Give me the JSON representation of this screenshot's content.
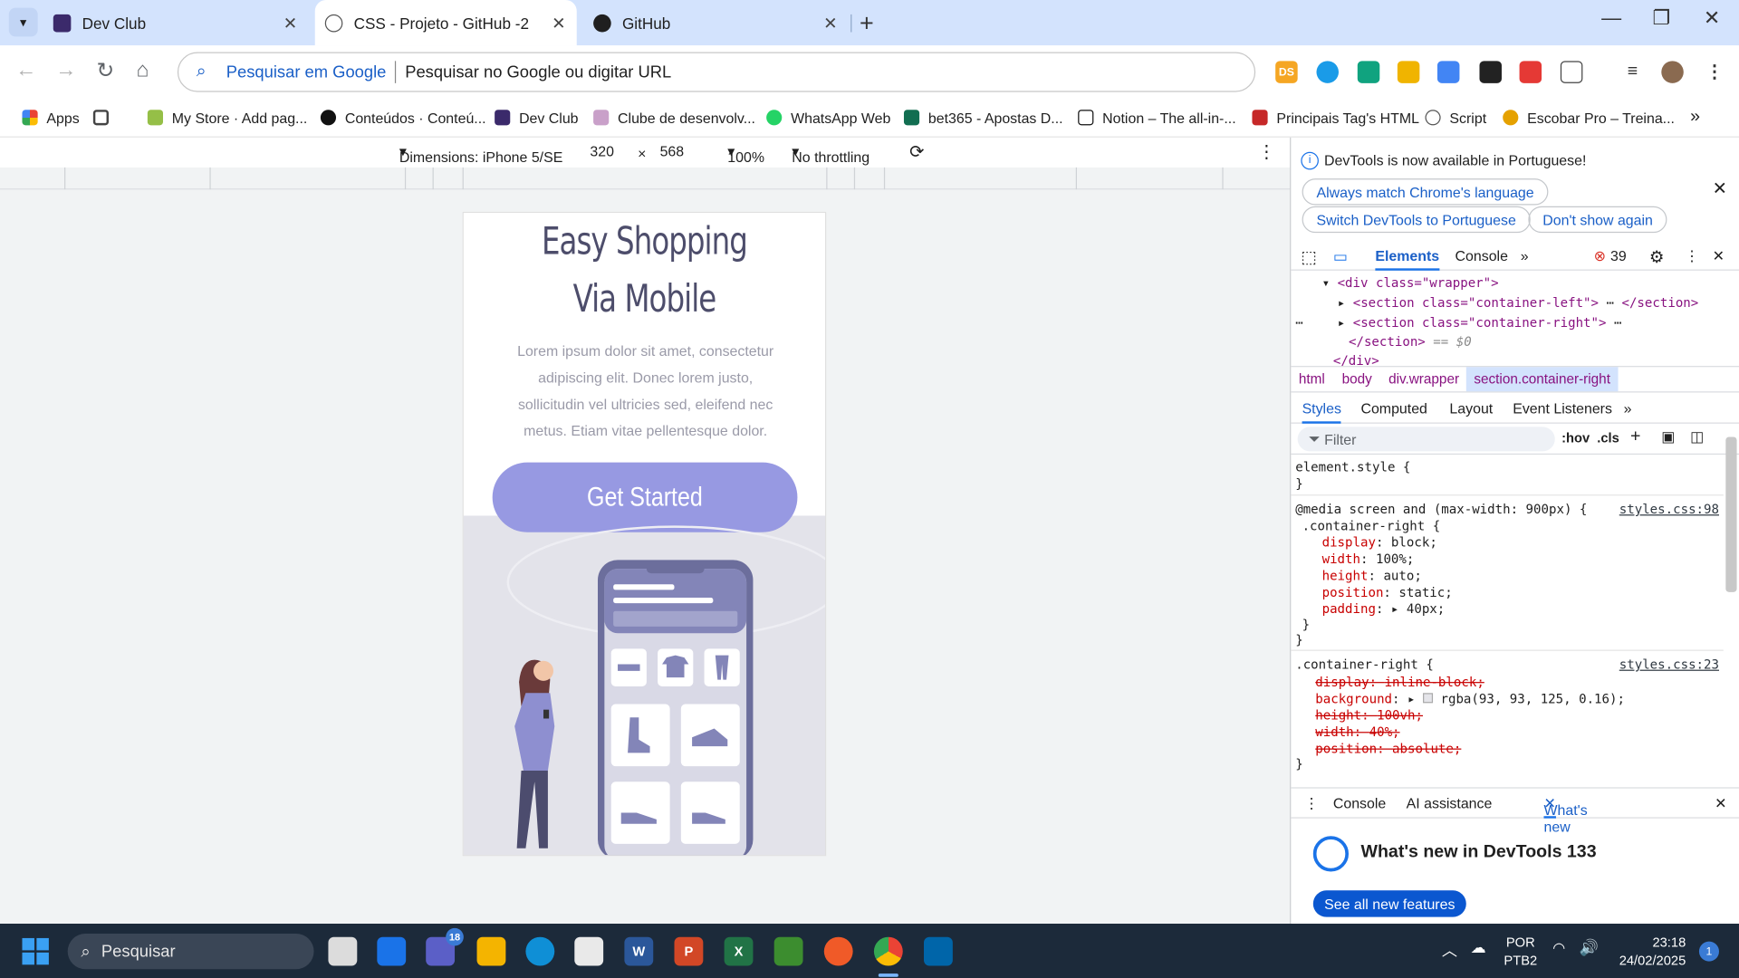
{
  "browser": {
    "tabs": [
      {
        "title": "Dev Club",
        "active": false
      },
      {
        "title": "CSS - Projeto - GitHub -2",
        "active": true
      },
      {
        "title": "GitHub",
        "active": false
      }
    ],
    "new_tab": "+",
    "omnibox": {
      "hint": "Pesquisar em Google",
      "placeholder": "Pesquisar no Google ou digitar URL"
    },
    "bookmarks": [
      "Apps",
      "My Store · Add pag...",
      "Conteúdos · Conteú...",
      "Dev Club",
      "Clube de desenvolv...",
      "WhatsApp Web",
      "bet365 - Apostas D...",
      "Notion – The all-in-...",
      "Principais Tag's HTML",
      "Script",
      "Escobar Pro – Treina..."
    ]
  },
  "device_toolbar": {
    "dimensions": "Dimensions: iPhone 5/SE",
    "width": "320",
    "times": "×",
    "height": "568",
    "zoom": "100%",
    "throttling": "No throttling"
  },
  "page": {
    "title_line1": "Easy Shopping",
    "title_line2": "Via Mobile",
    "text": "Lorem ipsum dolor sit amet, consectetur adipiscing elit. Donec lorem justo, sollicitudin vel ultricies sed, eleifend nec metus. Etiam vitae pellentesque dolor.",
    "cta": "Get Started"
  },
  "devtools": {
    "info": "DevTools is now available in Portuguese!",
    "pills": [
      "Always match Chrome's language",
      "Switch DevTools to Portuguese",
      "Don't show again"
    ],
    "tabs": [
      "Elements",
      "Console"
    ],
    "error_count": "39",
    "dom": {
      "wrapper_open": "<div class=\"wrapper\">",
      "left": "<section class=\"container-left\">",
      "left_close": "</section>",
      "right": "<section class=\"container-right\">",
      "right_close": "</section>",
      "eq": "== $0",
      "div_close": "</div>"
    },
    "crumbs": [
      "html",
      "body",
      "div.wrapper",
      "section.container-right"
    ],
    "style_tabs": [
      "Styles",
      "Computed",
      "Layout",
      "Event Listeners"
    ],
    "filter": "Filter",
    "hov": ":hov",
    "cls": ".cls",
    "rules": {
      "element_style": "element.style {",
      "close": "}",
      "media": "@media screen and (max-width: 900px) {",
      "media_selector": ".container-right {",
      "media_src": "styles.css:98",
      "media_props": [
        {
          "name": "display",
          "value": "block;"
        },
        {
          "name": "width",
          "value": "100%;"
        },
        {
          "name": "height",
          "value": "auto;"
        },
        {
          "name": "position",
          "value": "static;"
        },
        {
          "name": "padding",
          "value": "40px;"
        }
      ],
      "base_selector": ".container-right {",
      "base_src": "styles.css:23",
      "base_props": [
        {
          "name": "display",
          "value": "inline-block;",
          "struck": true
        },
        {
          "name": "background",
          "value": "rgba(93, 93, 125, 0.16);",
          "struck": false
        },
        {
          "name": "height",
          "value": "100vh;",
          "struck": true
        },
        {
          "name": "width",
          "value": "40%;",
          "struck": true
        },
        {
          "name": "position",
          "value": "absolute;",
          "struck": true
        }
      ]
    },
    "drawer_tabs": [
      "Console",
      "AI assistance",
      "What's new"
    ],
    "whats_new_title": "What's new in DevTools 133",
    "see_all": "See all new features"
  },
  "taskbar": {
    "search": "Pesquisar",
    "lang1": "POR",
    "lang2": "PTB2",
    "time": "23:18",
    "date": "24/02/2025",
    "teams_badge": "18",
    "notif": "1"
  },
  "colors": {
    "accent": "#9799e2",
    "title": "#4d4d6b",
    "tabstrip": "#d3e3fd",
    "taskbar": "#1c2a3a",
    "devtools_blue": "#1a73e8"
  }
}
